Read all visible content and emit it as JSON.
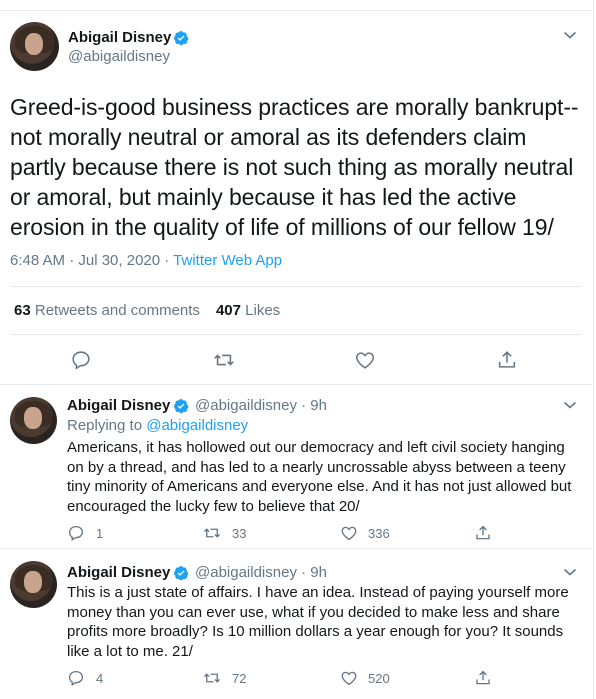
{
  "main": {
    "name": "Abigail Disney",
    "handle": "@abigaildisney",
    "text": "Greed-is-good business practices are morally bankrupt--not morally neutral or amoral as its defenders claim partly because there is not such thing as morally neutral or amoral, but mainly because it has led the active erosion in the quality of life of millions of our fellow 19/",
    "time_date": "6:48 AM · Jul 30, 2020 · ",
    "app": "Twitter Web App",
    "retweets_count": "63",
    "retweets_label": "Retweets and comments",
    "likes_count": "407",
    "likes_label": "Likes"
  },
  "replies": [
    {
      "name": "Abigail Disney",
      "handle_time": "@abigaildisney · 9h",
      "replying_prefix": "Replying to ",
      "replying_mention": "@abigaildisney",
      "text": "Americans, it has hollowed out our democracy and left civil society hanging on by a thread, and has led to a nearly uncrossable abyss between a teeny tiny minority of Americans and everyone else.  And it has not just allowed but encouraged the lucky few to believe that 20/",
      "replies": "1",
      "retweets": "33",
      "likes": "336"
    },
    {
      "name": "Abigail Disney",
      "handle_time": "@abigaildisney · 9h",
      "text": "This is a just state of affairs.  I have an idea.  Instead of paying yourself more money than you can ever use, what if you decided to make less and share profits more broadly?  Is 10 million dollars a year enough for you?  It sounds like a lot to me.  21/",
      "replies": "4",
      "retweets": "72",
      "likes": "520"
    }
  ],
  "icons": {
    "verified": "verified-badge-icon",
    "chevron": "chevron-down-icon",
    "reply": "reply-icon",
    "retweet": "retweet-icon",
    "like": "heart-icon",
    "share": "share-icon"
  },
  "colors": {
    "accent": "#1da1f2",
    "secondary_text": "#657786",
    "primary_text": "#14171a",
    "divider": "#e6ecf0"
  }
}
